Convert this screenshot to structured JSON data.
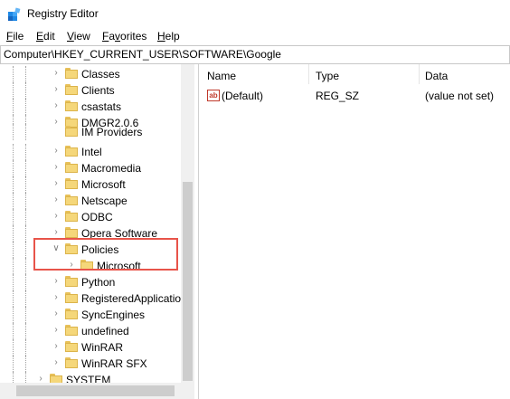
{
  "window": {
    "title": "Registry Editor"
  },
  "menu": [
    "File",
    "Edit",
    "View",
    "Favorites",
    "Help"
  ],
  "address": "Computer\\HKEY_CURRENT_USER\\SOFTWARE\\Google",
  "tree": [
    {
      "label": "Classes",
      "expanded": false
    },
    {
      "label": "Clients",
      "expanded": false
    },
    {
      "label": "csastats",
      "expanded": false
    },
    {
      "label": "DMGR2.0.6",
      "expanded": false
    },
    {
      "label": "IM Providers",
      "expanded": false
    },
    {
      "label": "Intel",
      "expanded": false
    },
    {
      "label": "Macromedia",
      "expanded": false
    },
    {
      "label": "Microsoft",
      "expanded": false
    },
    {
      "label": "Netscape",
      "expanded": false
    },
    {
      "label": "ODBC",
      "expanded": false
    },
    {
      "label": "Opera Software",
      "expanded": false
    },
    {
      "label": "Policies",
      "expanded": true
    },
    {
      "label": "Microsoft",
      "expanded": false
    },
    {
      "label": "Python",
      "expanded": false
    },
    {
      "label": "RegisteredApplicatio",
      "expanded": false
    },
    {
      "label": "SyncEngines",
      "expanded": false
    },
    {
      "label": "undefined",
      "expanded": false
    },
    {
      "label": "WinRAR",
      "expanded": false
    },
    {
      "label": "WinRAR SFX",
      "expanded": false
    },
    {
      "label": "SYSTEM",
      "expanded": false
    }
  ],
  "columns": {
    "name": "Name",
    "type": "Type",
    "data": "Data"
  },
  "values": [
    {
      "name": "(Default)",
      "type": "REG_SZ",
      "data": "(value not set)"
    }
  ],
  "colors": {
    "highlight_border": "#e8544a",
    "folder": "#f5d77a"
  }
}
